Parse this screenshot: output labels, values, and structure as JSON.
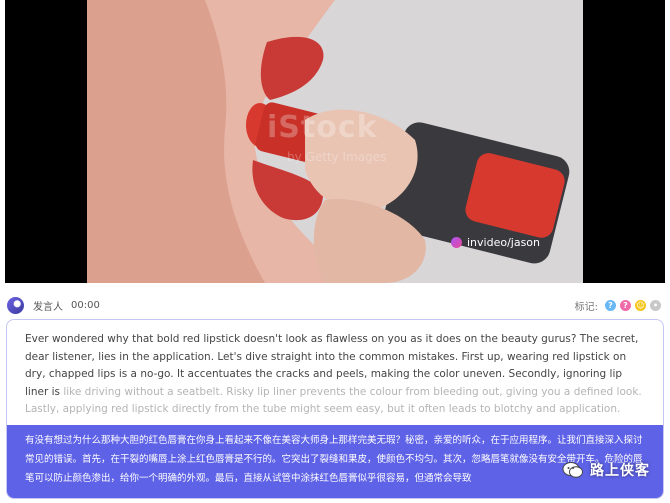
{
  "video": {
    "watermark_main": "iStock",
    "watermark_sub": "by Getty Images",
    "watermark_invideo": "invideo/jason"
  },
  "speaker": {
    "name": "发言人",
    "time": "00:00",
    "marker_label": "标记:",
    "marker_icons": [
      "question-icon",
      "help-icon",
      "smile-icon",
      "dot-icon"
    ]
  },
  "transcript": {
    "english_visible": "Ever wondered why that bold red lipstick doesn't look as flawless on you as it does on the beauty gurus? The secret, dear listener, lies in the application. Let's dive straight into the common mistakes. First up, wearing red lipstick on dry, chapped lips is a no-go. It accentuates the cracks and peels, making the color uneven. Secondly, ignoring lip liner is ",
    "english_faded": "like driving without a seatbelt. Risky lip liner prevents the colour from bleeding out, giving you a defined look. Lastly, applying red lipstick directly from the tube might seem easy, but it often leads to blotchy and application.",
    "chinese": "有没有想过为什么那种大胆的红色唇膏在你身上看起来不像在美容大师身上那样完美无瑕？秘密，亲爱的听众，在于应用程序。让我们直接深入探讨常见的错误。首先，在干裂的嘴唇上涂上红色唇膏是不行的。它突出了裂缝和果皮，使颜色不均匀。其次，忽略唇笔就像没有安全带开车。危险的唇笔可以防止颜色渗出，给你一个明确的外观。最后，直接从试管中涂抹红色唇膏似乎很容易，但通常会导致"
  },
  "channel": {
    "name": "路上侠客"
  },
  "colors": {
    "accent": "#5e62e6",
    "card_border": "#c5c6f3",
    "lipstick": "#d8392f"
  }
}
